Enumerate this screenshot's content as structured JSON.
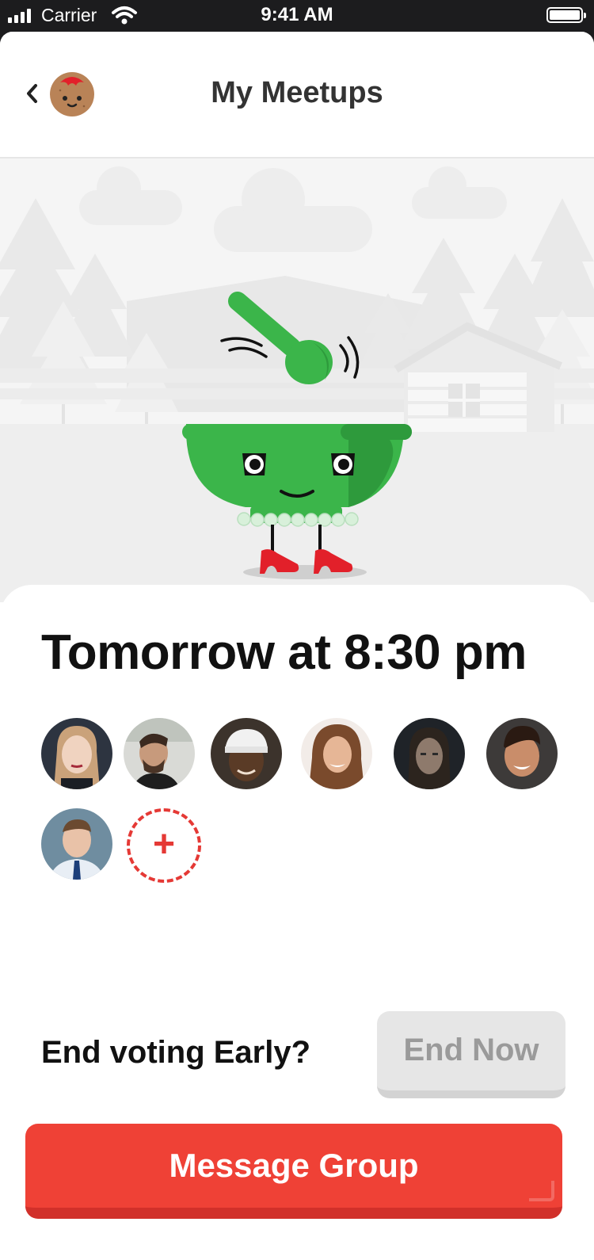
{
  "status_bar": {
    "carrier": "Carrier",
    "time": "9:41 AM"
  },
  "nav": {
    "title": "My Meetups",
    "back_icon": "chevron-left-icon",
    "avatar_icon": "potato-mascot-avatar"
  },
  "hero": {
    "illustration": "green-bowl-mascot-with-spoon",
    "background": "forest-and-cabin-scene"
  },
  "meetup": {
    "time_label": "Tomorrow at 8:30 pm",
    "attendees": [
      {
        "name": "attendee-1"
      },
      {
        "name": "attendee-2"
      },
      {
        "name": "attendee-3"
      },
      {
        "name": "attendee-4"
      },
      {
        "name": "attendee-5"
      },
      {
        "name": "attendee-6"
      },
      {
        "name": "attendee-7"
      }
    ],
    "add_label": "+"
  },
  "voting": {
    "label": "End voting Early?",
    "button_label": "End Now"
  },
  "actions": {
    "message_group_label": "Message Group"
  },
  "colors": {
    "accent_red": "#ef4136",
    "mascot_green": "#3bb54a",
    "disabled_gray": "#e6e6e6"
  }
}
